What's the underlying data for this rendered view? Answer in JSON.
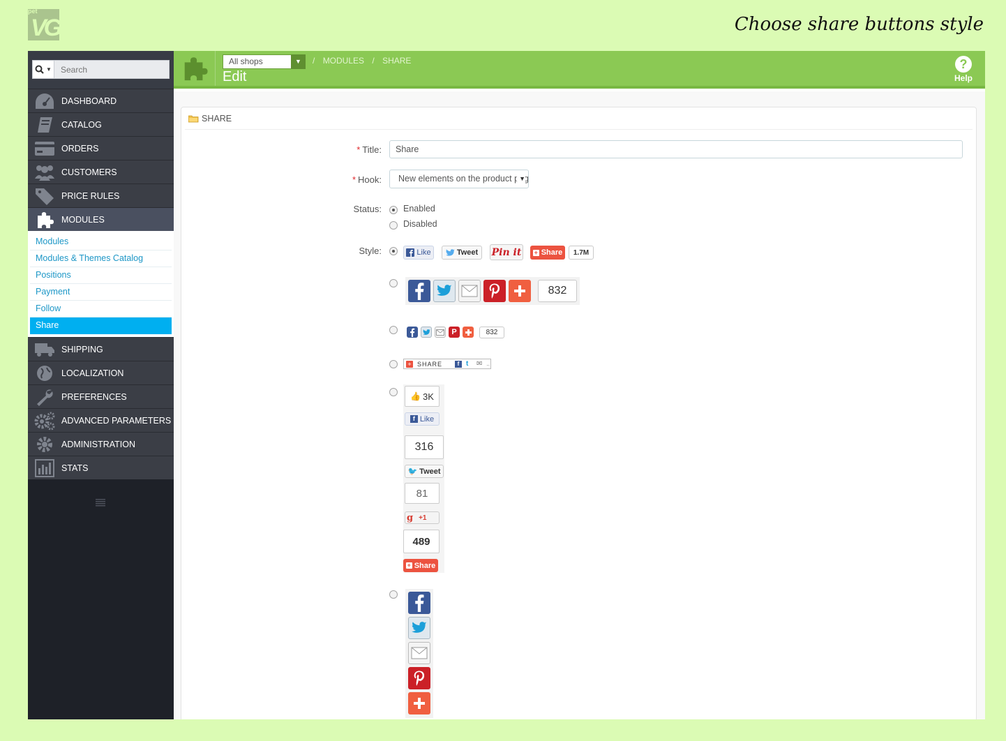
{
  "logo": {
    "small_text": "pet",
    "mark": "VG"
  },
  "caption": "Choose share buttons style",
  "search": {
    "placeholder": "Search"
  },
  "sidebar": {
    "items_top": [
      {
        "label": "DASHBOARD",
        "icon": "dashboard-icon"
      },
      {
        "label": "CATALOG",
        "icon": "book-icon"
      },
      {
        "label": "ORDERS",
        "icon": "credit-card-icon"
      },
      {
        "label": "CUSTOMERS",
        "icon": "users-icon"
      },
      {
        "label": "PRICE RULES",
        "icon": "tags-icon"
      },
      {
        "label": "MODULES",
        "icon": "puzzle-icon"
      }
    ],
    "submenu": [
      "Modules",
      "Modules & Themes Catalog",
      "Positions",
      "Payment",
      "Follow",
      "Share"
    ],
    "items_bottom": [
      {
        "label": "SHIPPING",
        "icon": "truck-icon"
      },
      {
        "label": "LOCALIZATION",
        "icon": "globe-icon"
      },
      {
        "label": "PREFERENCES",
        "icon": "wrench-icon"
      },
      {
        "label": "ADVANCED PARAMETERS",
        "icon": "gears-icon"
      },
      {
        "label": "ADMINISTRATION",
        "icon": "gear-icon"
      },
      {
        "label": "STATS",
        "icon": "bar-chart-icon"
      }
    ]
  },
  "toolbar": {
    "shop": "All shops",
    "breadcrumb": [
      "MODULES",
      "/",
      "SHARE"
    ],
    "title": "Edit",
    "help": "Help"
  },
  "panel": {
    "heading": "SHARE",
    "title_label": "Title:",
    "title_value": "Share",
    "hook_label": "Hook:",
    "hook_value": "New elements on the product page",
    "status_label": "Status:",
    "status_options": [
      "Enabled",
      "Disabled"
    ],
    "style_label": "Style:"
  },
  "styles": {
    "s1": {
      "like": "Like",
      "tweet": "Tweet",
      "pin": "Pin it",
      "share": "Share",
      "count": "1.7M"
    },
    "s2": {
      "count": "832"
    },
    "s3": {
      "count": "832"
    },
    "s4": {
      "share": "SHARE"
    },
    "s5": {
      "fb_count": "3K",
      "like": "Like",
      "tw_count": "316",
      "tweet": "Tweet",
      "gp_count": "81",
      "plus": "+1",
      "share_count": "489",
      "share": "Share"
    }
  },
  "colors": {
    "accent": "#8bc954",
    "sidebar": "#1e2128",
    "active_sub": "#00aff0",
    "background": "#dbfbb4"
  }
}
